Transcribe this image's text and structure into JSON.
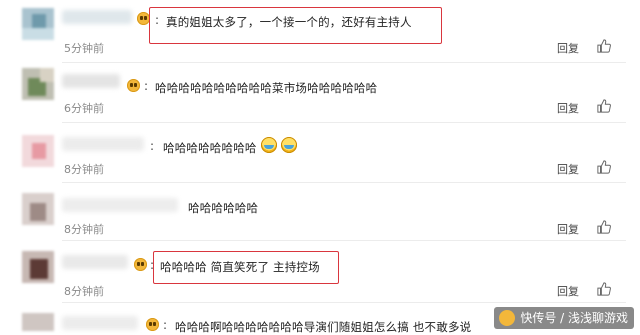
{
  "comments": [
    {
      "text": "真的姐姐太多了，一个接一个的，还好有主持人",
      "time": "5分钟前",
      "reply": "回复"
    },
    {
      "text": "哈哈哈哈哈哈哈哈哈哈菜市场哈哈哈哈哈哈",
      "time": "6分钟前",
      "reply": "回复"
    },
    {
      "text": "哈哈哈哈哈哈哈哈",
      "time": "8分钟前",
      "reply": "回复"
    },
    {
      "text": "哈哈哈哈哈哈",
      "time": "8分钟前",
      "reply": "回复"
    },
    {
      "text": "哈哈哈哈 简直笑死了 主持控场",
      "time": "8分钟前",
      "reply": "回复"
    },
    {
      "text": "哈哈哈啊哈哈哈哈哈哈哈导演们随姐姐怎么搞 也不敢多说"
    }
  ],
  "colon": ":",
  "watermark": {
    "text": "快传号 / 浅浅聊游戏"
  },
  "colors": {
    "highlight": "#d9363e",
    "time": "#8a8a8a"
  },
  "icons": {
    "like": "thumbs-up-icon",
    "emoji": "smiley-face-icon",
    "laugh": "laughing-tears-icon"
  }
}
